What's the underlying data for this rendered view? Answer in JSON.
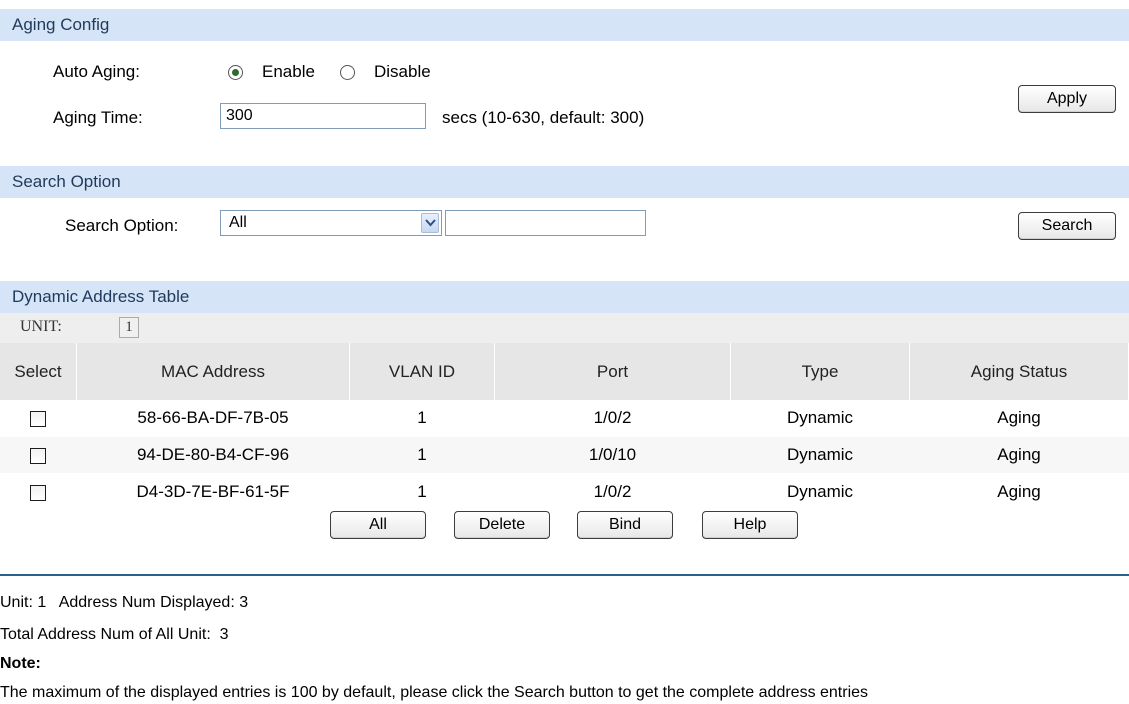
{
  "aging_config": {
    "header": "Aging Config",
    "auto_aging_label": "Auto Aging:",
    "enable_label": "Enable",
    "disable_label": "Disable",
    "auto_aging_value": "Enable",
    "aging_time_label": "Aging Time:",
    "aging_time_value": "300",
    "aging_time_hint": "secs (10-630, default: 300)",
    "apply_label": "Apply"
  },
  "search_option": {
    "header": "Search Option",
    "label": "Search Option:",
    "selected": "All",
    "text_value": "",
    "search_label": "Search"
  },
  "dynamic_table": {
    "header": "Dynamic Address Table",
    "unit_label": "UNIT:",
    "unit_value": "1",
    "columns": [
      "Select",
      "MAC Address",
      "VLAN ID",
      "Port",
      "Type",
      "Aging Status"
    ],
    "rows": [
      {
        "mac": "58-66-BA-DF-7B-05",
        "vlan": "1",
        "port": "1/0/2",
        "type": "Dynamic",
        "status": "Aging",
        "selected": false
      },
      {
        "mac": "94-DE-80-B4-CF-96",
        "vlan": "1",
        "port": "1/0/10",
        "type": "Dynamic",
        "status": "Aging",
        "selected": false
      },
      {
        "mac": "D4-3D-7E-BF-61-5F",
        "vlan": "1",
        "port": "1/0/2",
        "type": "Dynamic",
        "status": "Aging",
        "selected": false
      }
    ],
    "buttons": {
      "all": "All",
      "delete": "Delete",
      "bind": "Bind",
      "help": "Help"
    }
  },
  "footer": {
    "unit_line": "Unit: 1   Address Num Displayed: 3",
    "total_line": "Total Address Num of All Unit:  3",
    "note_title": "Note:",
    "note_text": "The maximum of the displayed entries is 100 by default, please click the Search button to get the complete address entries"
  },
  "colors": {
    "section_header_bg": "#d6e4f7",
    "table_header_bg": "#e6e6e6",
    "divider": "#2a6287"
  }
}
